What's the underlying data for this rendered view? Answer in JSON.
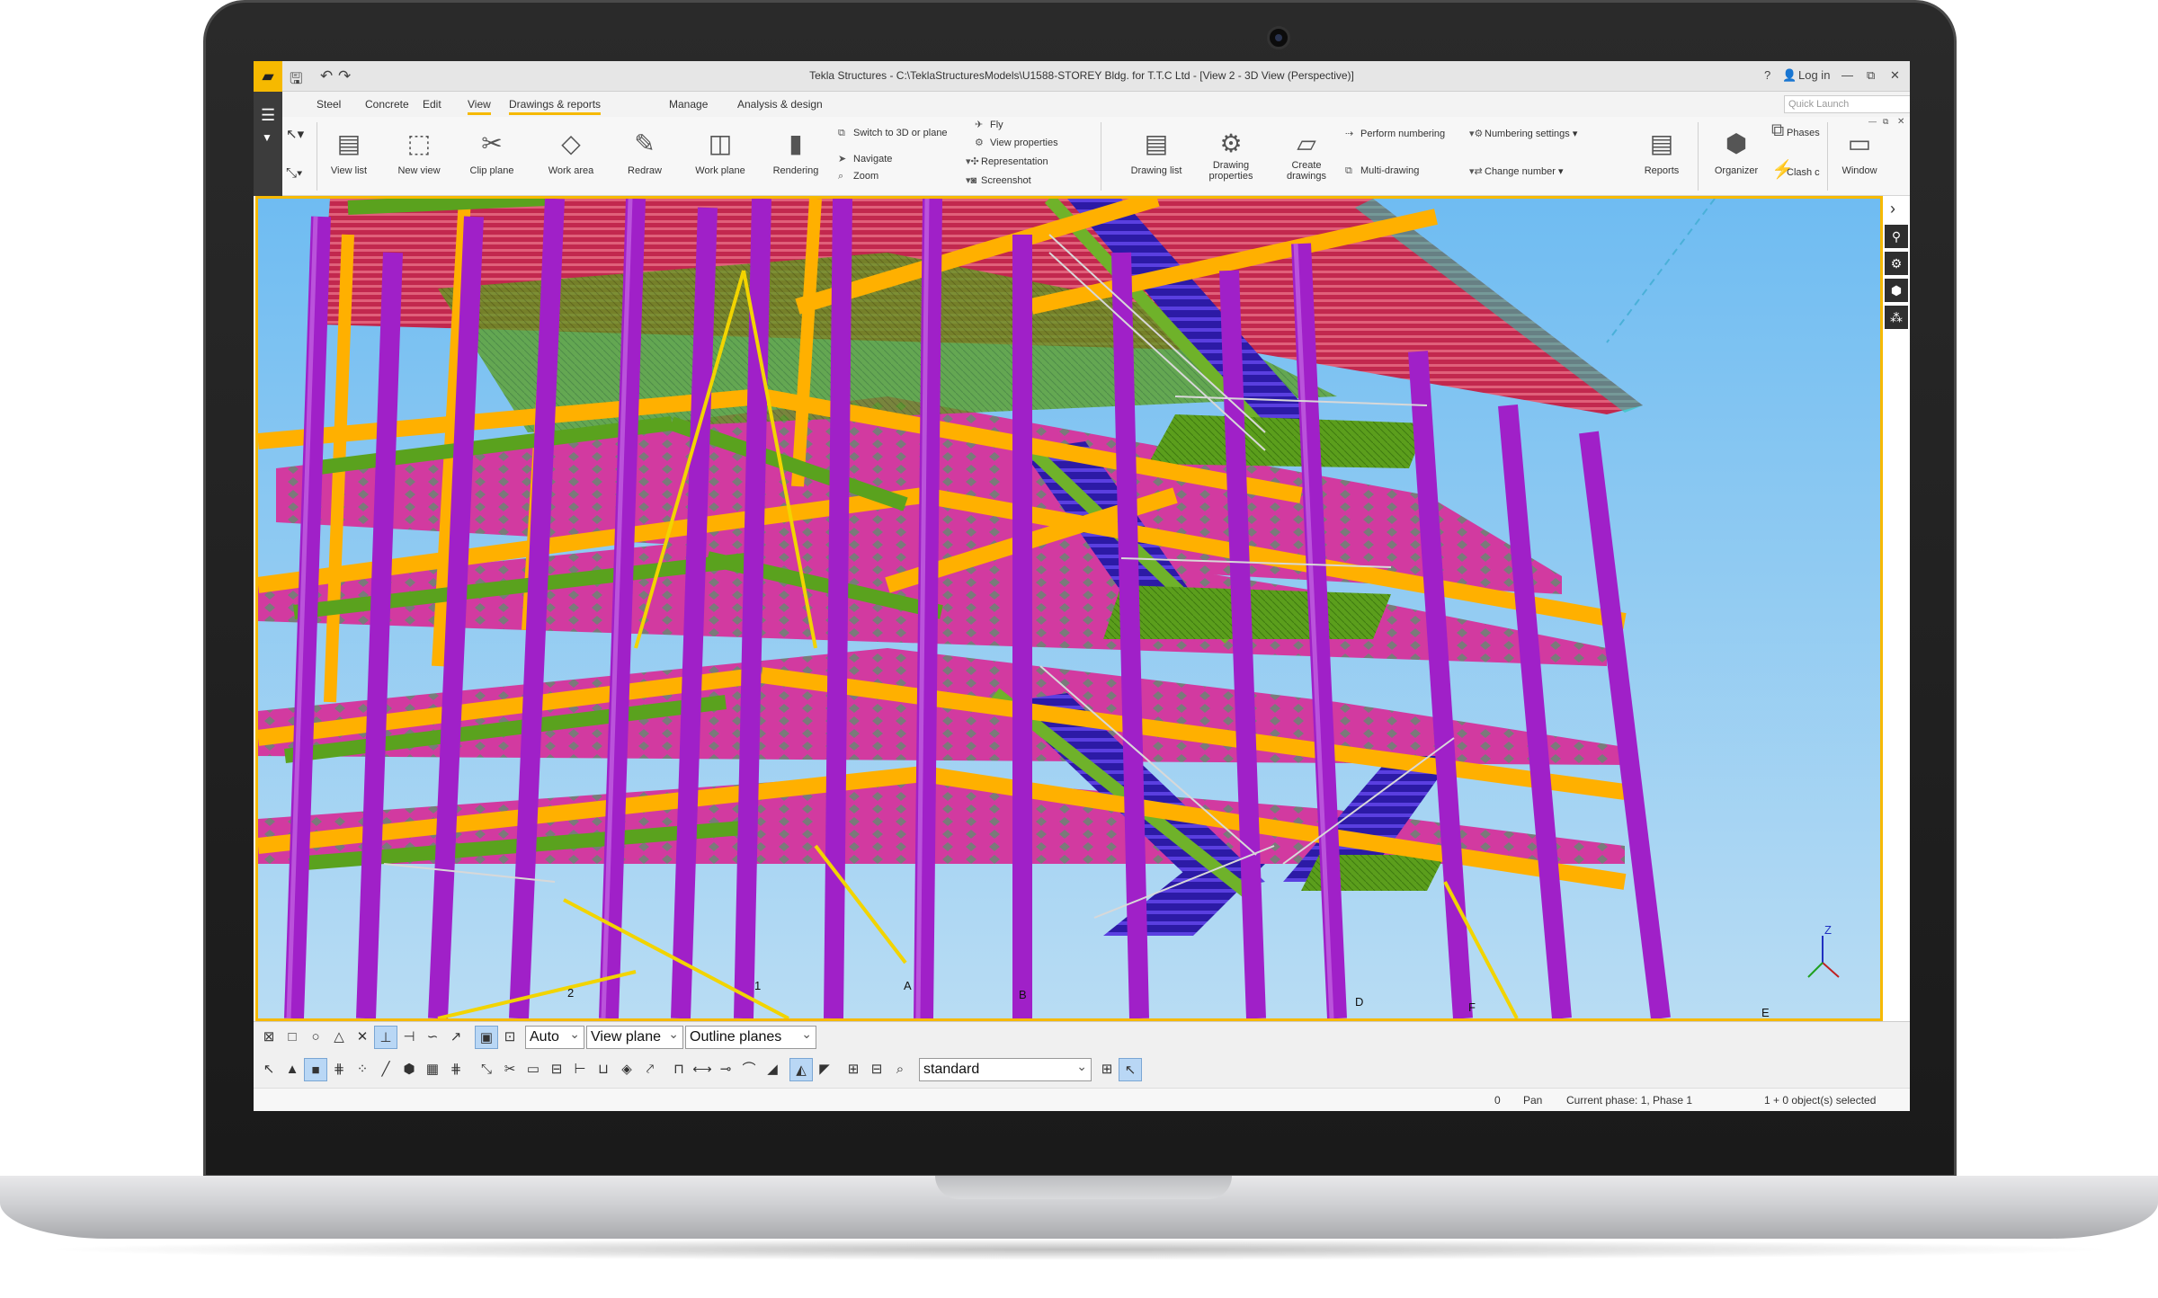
{
  "window": {
    "title": "Tekla Structures - C:\\TeklaStructuresModels\\U1588-STOREY Bldg. for T.T.C Ltd  - [View 2 - 3D View (Perspective)]",
    "help": "?",
    "login": "Log in",
    "minimize": "—",
    "maximize": "⧉",
    "close": "✕"
  },
  "menu": {
    "tabs": [
      "Steel",
      "Concrete",
      "Edit",
      "View",
      "Drawings & reports",
      "Manage",
      "Analysis & design"
    ],
    "active": "View",
    "quick_launch_placeholder": "Quick Launch"
  },
  "ribbon": {
    "view_list": "View list",
    "new_view": "New view",
    "clip_plane": "Clip plane",
    "work_area": "Work area",
    "redraw": "Redraw",
    "work_plane": "Work plane",
    "rendering": "Rendering",
    "switch_3d": "Switch to 3D or plane",
    "navigate": "Navigate",
    "zoom": "Zoom",
    "fly": "Fly",
    "view_properties": "View properties",
    "representation": "Representation",
    "screenshot": "Screenshot",
    "drawing_list": "Drawing list",
    "drawing_properties_1": "Drawing",
    "drawing_properties_2": "properties",
    "create_drawings_1": "Create",
    "create_drawings_2": "drawings",
    "perform_numbering": "Perform numbering",
    "multi_drawing": "Multi-drawing",
    "numbering_settings": "Numbering settings",
    "change_number": "Change number",
    "reports": "Reports",
    "organizer": "Organizer",
    "phases": "Phases",
    "clash": "Clash c",
    "window": "Window"
  },
  "viewport": {
    "grid_labels": [
      "2",
      "1",
      "A",
      "B",
      "D",
      "F",
      "E"
    ],
    "axis_label": "Z"
  },
  "toolbar": {
    "auto": "Auto",
    "view_plane": "View plane",
    "outline_planes": "Outline planes",
    "standard": "standard"
  },
  "status": {
    "count": "0",
    "mode": "Pan",
    "phase": "Current phase: 1, Phase 1",
    "objects": "1 + 0 object(s) selected"
  },
  "colors": {
    "accent": "#f6b900",
    "sky": "#7fc3f0",
    "column": "#a020c8",
    "beam_orange": "#ffb000",
    "brace_green": "#5aa21e",
    "deck_red": "#c0305a",
    "stair": "#3a1ab0"
  }
}
